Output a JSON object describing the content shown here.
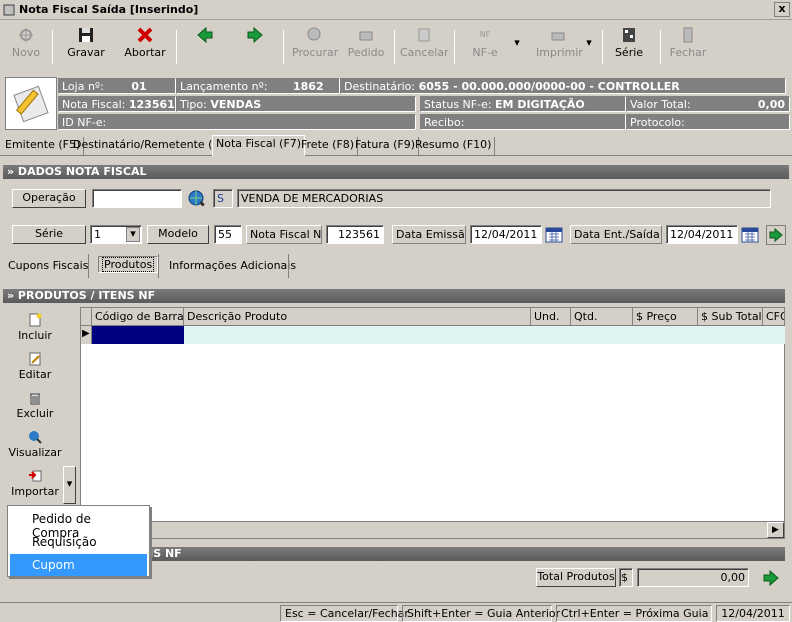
{
  "window": {
    "title": "Nota Fiscal Saída [Inserindo]",
    "close": "x"
  },
  "toolbar": {
    "novo": "Novo",
    "gravar": "Gravar",
    "abortar": "Abortar",
    "procurar": "Procurar",
    "pedido": "Pedido",
    "cancelar": "Cancelar",
    "nfe": "NF-e",
    "nfe_small": "NF",
    "imprimir": "Imprimir",
    "serie": "Série",
    "fechar": "Fechar"
  },
  "info": {
    "loja_label": "Loja nº:",
    "loja_value": "01",
    "lanc_label": "Lançamento nº:",
    "lanc_value": "1862",
    "dest_label": "Destinatário:",
    "dest_value": "6055 - 00.000.000/0000-00 - CONTROLLER",
    "nf_label": "Nota Fiscal:",
    "nf_value": "123561",
    "tipo_label": "Tipo:",
    "tipo_value": "VENDAS",
    "status_label": "Status NF-e:",
    "status_value": "EM DIGITAÇÃO",
    "valor_label": "Valor Total:",
    "valor_value": "0,00",
    "idnfe_label": "ID NF-e:",
    "recibo_label": "Recibo:",
    "protocolo_label": "Protocolo:"
  },
  "tabs": [
    "Emitente (F5)",
    "Destinatário/Remetente (F6)",
    "Nota Fiscal (F7)",
    "Frete (F8)",
    "Fatura (F9)",
    "Resumo (F10)"
  ],
  "dados": {
    "section": "» DADOS NOTA FISCAL",
    "operacao_label": "Operação",
    "operacao_value": "",
    "op_code": "S",
    "op_desc": "VENDA DE MERCADORIAS",
    "serie_label": "Série",
    "serie_value": "1",
    "modelo_label": "Modelo",
    "modelo_value": "55",
    "nfnum_label": "Nota Fiscal Nº",
    "nfnum_value": "123561",
    "emissao_label": "Data Emissão",
    "emissao_value": "12/04/2011",
    "entsai_label": "Data Ent./Saída",
    "entsai_value": "12/04/2011"
  },
  "subtabs": [
    "Cupons Fiscais",
    "Produtos",
    "Informações Adicionais"
  ],
  "produtos": {
    "section": "» PRODUTOS / ITENS NF",
    "columns": [
      "Código de Barras",
      "Descrição Produto",
      "Und.",
      "Qtd.",
      "$ Preço",
      "$ Sub Total",
      "CFO"
    ],
    "actions": [
      "Incluir",
      "Editar",
      "Excluir",
      "Visualizar",
      "Importar"
    ]
  },
  "menu": {
    "items": [
      "Pedido de Compra",
      "Requisição",
      "Cupom"
    ],
    "selected": 2
  },
  "servicos": {
    "section_partial": "NS NF",
    "total_label": "Total Produtos",
    "currency": "$",
    "total_value": "0,00"
  },
  "status": {
    "esc": "Esc = Cancelar/Fechar",
    "shift": "Shift+Enter = Guia Anterior",
    "ctrl": "Ctrl+Enter = Próxima Guia",
    "date": "12/04/2011"
  }
}
